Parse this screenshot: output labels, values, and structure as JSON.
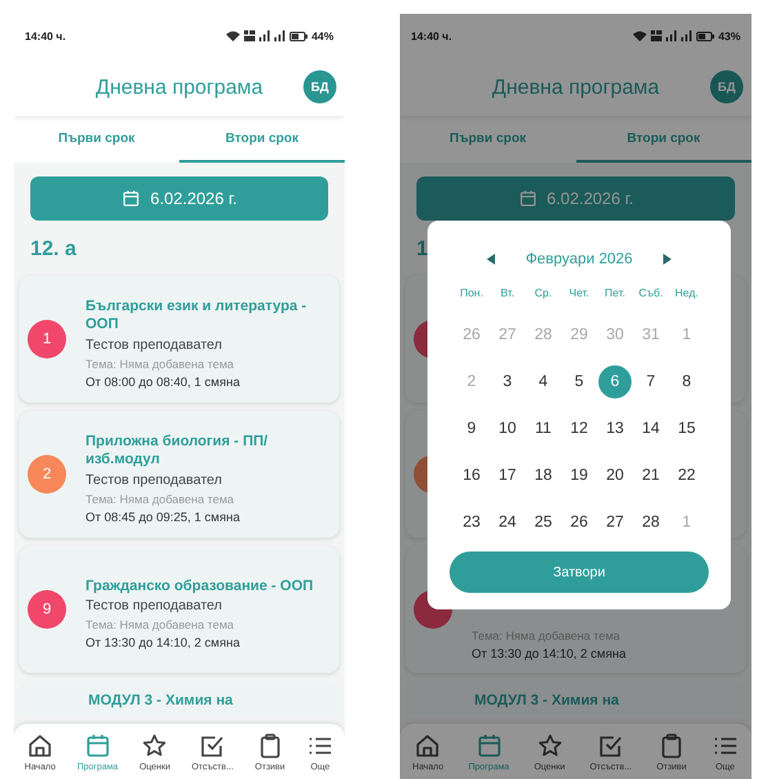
{
  "phones": [
    {
      "status": {
        "time": "14:40 ч.",
        "battery": "44%"
      },
      "header": {
        "title": "Дневна програма",
        "avatar": "БД"
      },
      "tabs": [
        {
          "label": "Първи срок",
          "selected": false
        },
        {
          "label": "Втори срок",
          "selected": true
        }
      ],
      "date_button": "6.02.2026 г.",
      "class_heading": "12. а",
      "lessons": [
        {
          "number": "1",
          "color": "#f0476a",
          "subject": "Български език и литература - ООП",
          "teacher": "Тестов преподавател",
          "topic": "Тема: Няма добавена тема",
          "time": "От 08:00 до 08:40, 1 смяна"
        },
        {
          "number": "2",
          "color": "#f8875a",
          "subject": "Приложна биология - ПП/ изб.модул",
          "teacher": "Тестов преподавател",
          "topic": "Тема: Няма добавена тема",
          "time": "От 08:45 до 09:25, 1 смяна"
        },
        {
          "number": "9",
          "color": "#f0476a",
          "subject": "Гражданско образование - ООП",
          "teacher": "Тестов преподавател",
          "topic": "Тема: Няма добавена тема",
          "time": "От 13:30 до 14:10, 2 смяна"
        },
        {
          "subject": "МОДУЛ 3 - Химия на"
        }
      ],
      "nav": [
        {
          "label": "Начало",
          "selected": false
        },
        {
          "label": "Програма",
          "selected": true
        },
        {
          "label": "Оценки",
          "selected": false
        },
        {
          "label": "Отсъств...",
          "selected": false
        },
        {
          "label": "Отзиви",
          "selected": false
        },
        {
          "label": "Още",
          "selected": false
        }
      ]
    },
    {
      "status": {
        "time": "14:40 ч.",
        "battery": "43%"
      },
      "header": {
        "title": "Дневна програма",
        "avatar": "БД"
      },
      "tabs": [
        {
          "label": "Първи срок",
          "selected": false
        },
        {
          "label": "Втори срок",
          "selected": true
        }
      ],
      "date_button": "6.02.2026 г.",
      "class_heading": "1",
      "lessons": [
        {
          "color": "#8b293d"
        },
        {
          "color": "#904e34"
        },
        {
          "color": "#8b293d",
          "topic": "Тема: Няма добавена тема",
          "time": "От 13:30 до 14:10, 2 смяна"
        },
        {
          "subject": "МОДУЛ 3 - Химия на"
        }
      ],
      "nav": [
        {
          "label": "Начало",
          "selected": false
        },
        {
          "label": "Програма",
          "selected": true
        },
        {
          "label": "Оценки",
          "selected": false
        },
        {
          "label": "Отсъств...",
          "selected": false
        },
        {
          "label": "Отзиви",
          "selected": false
        },
        {
          "label": "Още",
          "selected": false
        }
      ],
      "date_picker": {
        "month": "Февруари 2026",
        "weekdays": [
          "Пон.",
          "Вт.",
          "Ср.",
          "Чет.",
          "Пет.",
          "Съб.",
          "Нед."
        ],
        "days": [
          {
            "day": "26",
            "muted": true,
            "selected": false
          },
          {
            "day": "27",
            "muted": true,
            "selected": false
          },
          {
            "day": "28",
            "muted": true,
            "selected": false
          },
          {
            "day": "29",
            "muted": true,
            "selected": false
          },
          {
            "day": "30",
            "muted": true,
            "selected": false
          },
          {
            "day": "31",
            "muted": true,
            "selected": false
          },
          {
            "day": "1",
            "muted": true,
            "selected": false
          },
          {
            "day": "2",
            "muted": true,
            "selected": false
          },
          {
            "day": "3",
            "muted": false,
            "selected": false
          },
          {
            "day": "4",
            "muted": false,
            "selected": false
          },
          {
            "day": "5",
            "muted": false,
            "selected": false
          },
          {
            "day": "6",
            "muted": false,
            "selected": true
          },
          {
            "day": "7",
            "muted": false,
            "selected": false
          },
          {
            "day": "8",
            "muted": false,
            "selected": false
          },
          {
            "day": "9",
            "muted": false,
            "selected": false
          },
          {
            "day": "10",
            "muted": false,
            "selected": false
          },
          {
            "day": "11",
            "muted": false,
            "selected": false
          },
          {
            "day": "12",
            "muted": false,
            "selected": false
          },
          {
            "day": "13",
            "muted": false,
            "selected": false
          },
          {
            "day": "14",
            "muted": false,
            "selected": false
          },
          {
            "day": "15",
            "muted": false,
            "selected": false
          },
          {
            "day": "16",
            "muted": false,
            "selected": false
          },
          {
            "day": "17",
            "muted": false,
            "selected": false
          },
          {
            "day": "18",
            "muted": false,
            "selected": false
          },
          {
            "day": "19",
            "muted": false,
            "selected": false
          },
          {
            "day": "20",
            "muted": false,
            "selected": false
          },
          {
            "day": "21",
            "muted": false,
            "selected": false
          },
          {
            "day": "22",
            "muted": false,
            "selected": false
          },
          {
            "day": "23",
            "muted": false,
            "selected": false
          },
          {
            "day": "24",
            "muted": false,
            "selected": false
          },
          {
            "day": "25",
            "muted": false,
            "selected": false
          },
          {
            "day": "26",
            "muted": false,
            "selected": false
          },
          {
            "day": "27",
            "muted": false,
            "selected": false
          },
          {
            "day": "28",
            "muted": false,
            "selected": false
          },
          {
            "day": "1",
            "muted": true,
            "selected": false
          }
        ],
        "close_button": "Затвори"
      }
    }
  ]
}
